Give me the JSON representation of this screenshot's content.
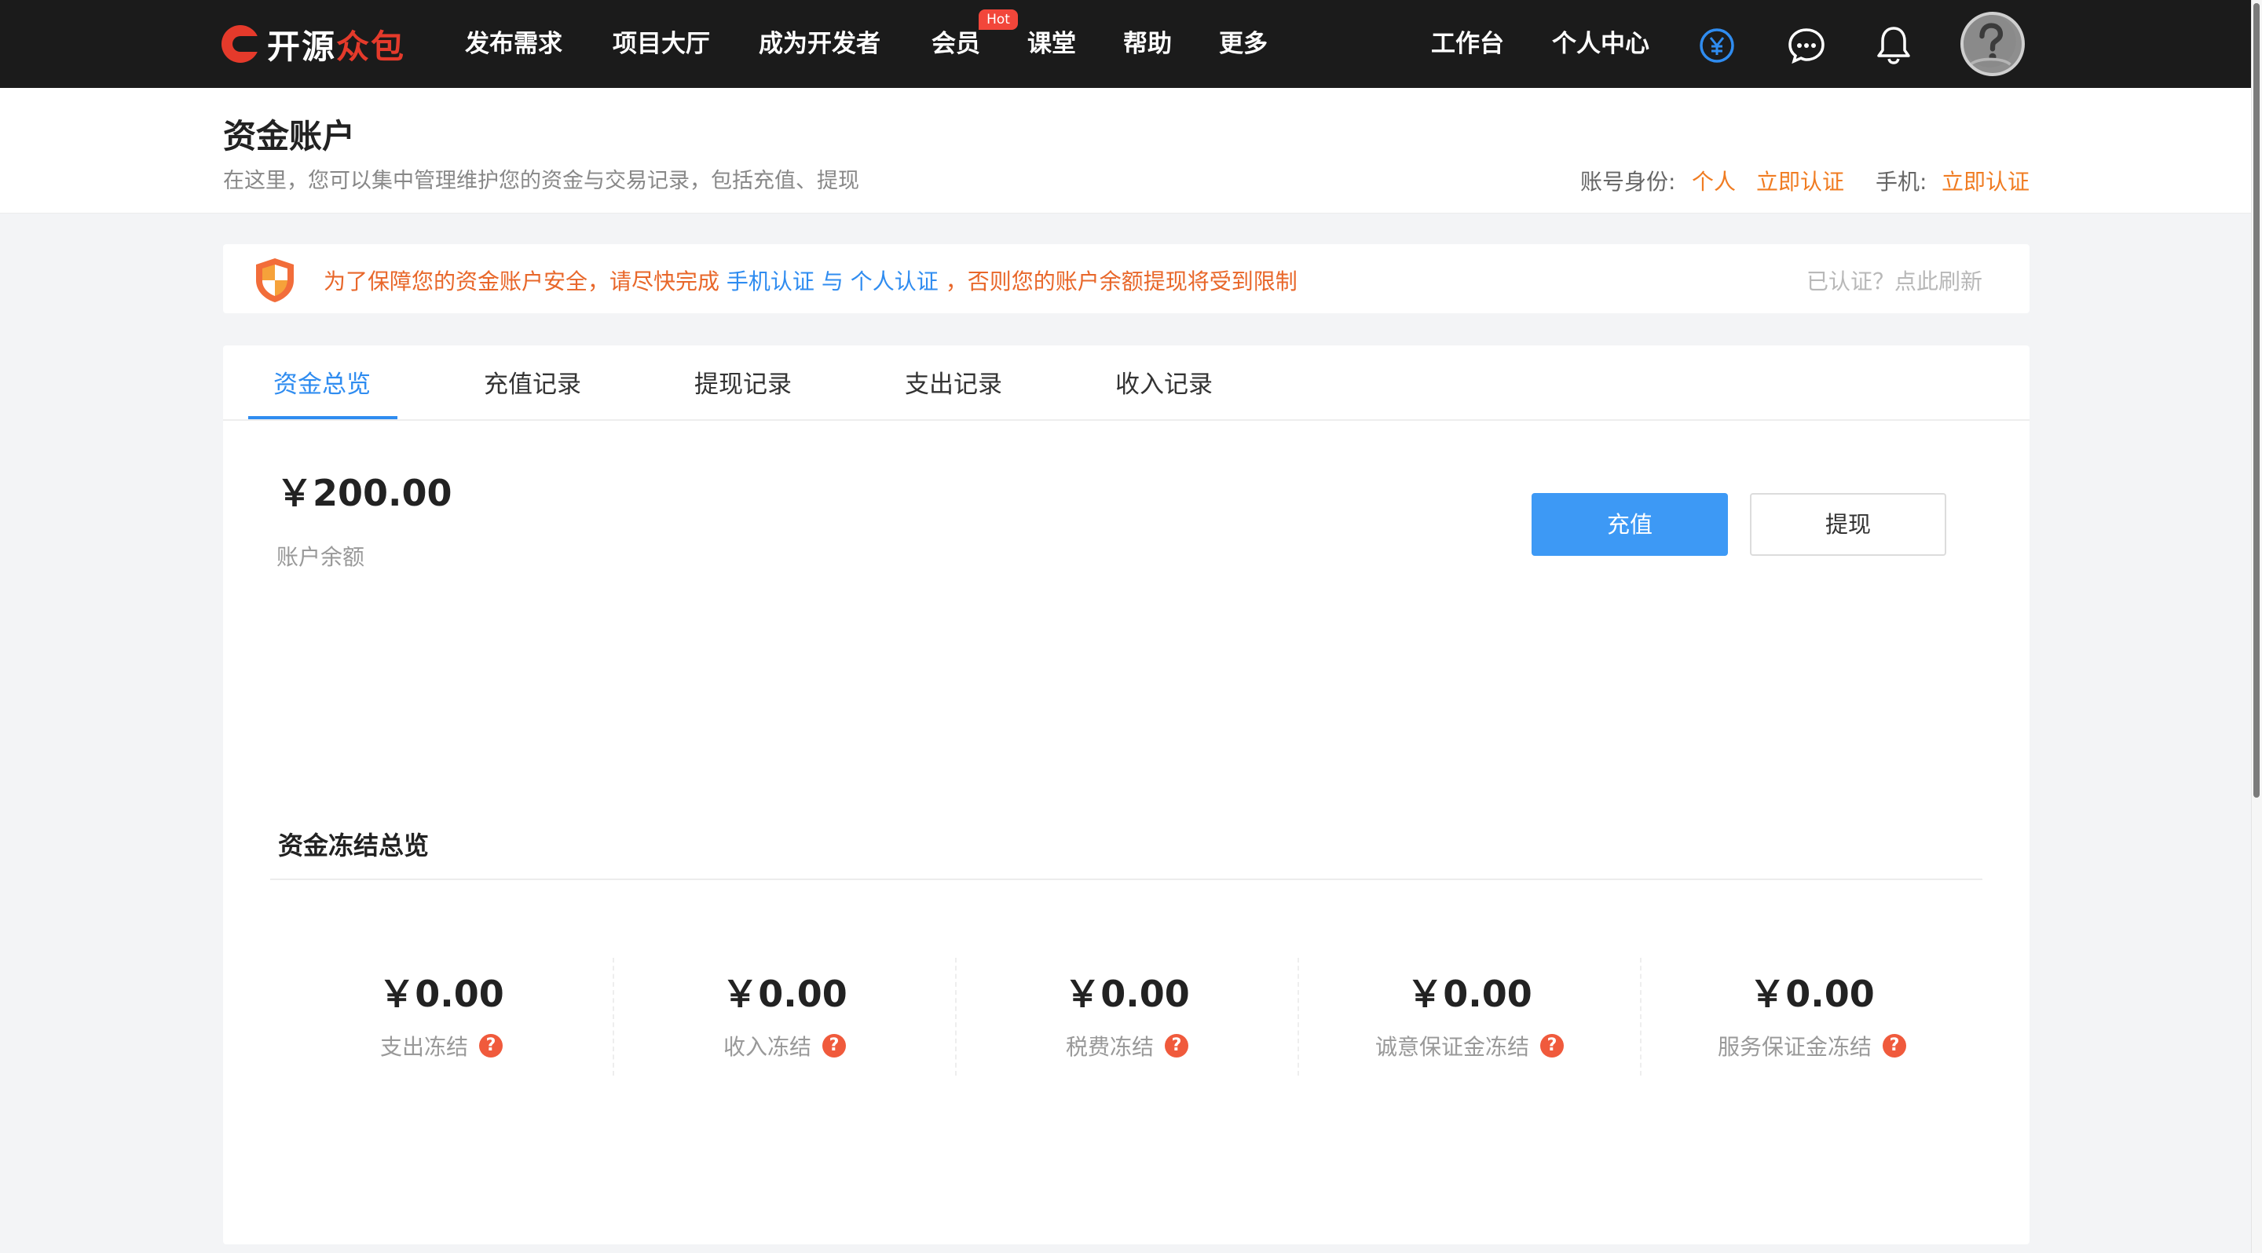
{
  "nav": {
    "logo_left": "开源",
    "logo_right": "众包",
    "items": [
      "发布需求",
      "项目大厅",
      "成为开发者",
      "会员",
      "课堂",
      "帮助",
      "更多"
    ],
    "hot_badge": "Hot",
    "right_items": [
      "工作台",
      "个人中心"
    ],
    "icons": [
      "yuan-icon",
      "chat-icon",
      "bell-icon"
    ]
  },
  "header": {
    "title": "资金账户",
    "subtitle": "在这里，您可以集中管理维护您的资金与交易记录，包括充值、提现",
    "identity_label": "账号身份:",
    "identity_value": "个人",
    "identity_action": "立即认证",
    "phone_label": "手机:",
    "phone_action": "立即认证"
  },
  "notice": {
    "text_a": "为了保障您的资金账户安全，请尽快完成",
    "link_phone": "手机认证",
    "text_b": "与",
    "link_person": "个人认证",
    "text_c": "，否则您的账户余额提现将受到限制",
    "refresh": "已认证？点此刷新"
  },
  "tabs": {
    "items": [
      "资金总览",
      "充值记录",
      "提现记录",
      "支出记录",
      "收入记录"
    ],
    "active": 0
  },
  "overview": {
    "balance": "￥200.00",
    "balance_label": "账户余额",
    "recharge_button": "充值",
    "withdraw_button": "提现"
  },
  "freeze": {
    "title": "资金冻结总览",
    "items": [
      {
        "amount": "￥0.00",
        "label": "支出冻结"
      },
      {
        "amount": "￥0.00",
        "label": "收入冻结"
      },
      {
        "amount": "￥0.00",
        "label": "税费冻结"
      },
      {
        "amount": "￥0.00",
        "label": "诚意保证金冻结"
      },
      {
        "amount": "￥0.00",
        "label": "服务保证金冻结"
      }
    ],
    "help_glyph": "?"
  },
  "colors": {
    "accent_blue": "#2f8cf0",
    "accent_orange": "#f07c22",
    "brand_red": "#e53a2b",
    "nav_bg": "#1b1b1b"
  }
}
